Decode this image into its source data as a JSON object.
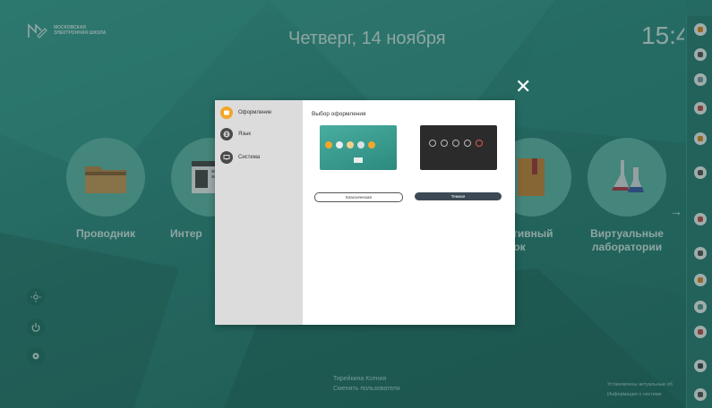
{
  "header": {
    "logo_text": "МОСКОВСКАЯ ЭЛЕКТРОННАЯ ШКОЛА",
    "date": "Четверг, 14 ноября",
    "time": "15:4"
  },
  "tiles": [
    {
      "label": "Проводник",
      "icon": "folder-icon"
    },
    {
      "label": "Интер",
      "icon": "browser-icon"
    },
    {
      "label": "ктивный\nрок",
      "icon": "book-icon"
    },
    {
      "label": "Виртуальные\nлаборатории",
      "icon": "flask-icon"
    }
  ],
  "footer": {
    "user_name": "Тирейкина Ксения",
    "user_action": "Сменить пользователя",
    "status_line1": "Установлены актуальные об",
    "status_line2": "Информация о системе"
  },
  "dialog": {
    "menu": [
      {
        "label": "Оформление",
        "icon": "palette-icon",
        "color": "#f2a62a"
      },
      {
        "label": "Язык",
        "icon": "globe-icon",
        "color": "#4a4a4a"
      },
      {
        "label": "Система",
        "icon": "monitor-icon",
        "color": "#4a4a4a"
      }
    ],
    "title": "Выбор оформления",
    "themes": [
      {
        "label": "Классическая",
        "selected": false
      },
      {
        "label": "Темная",
        "selected": true
      }
    ]
  },
  "colors": {
    "accent": "#f2a62a",
    "background": "#2f8f83",
    "dark_button": "#3d4a55"
  }
}
